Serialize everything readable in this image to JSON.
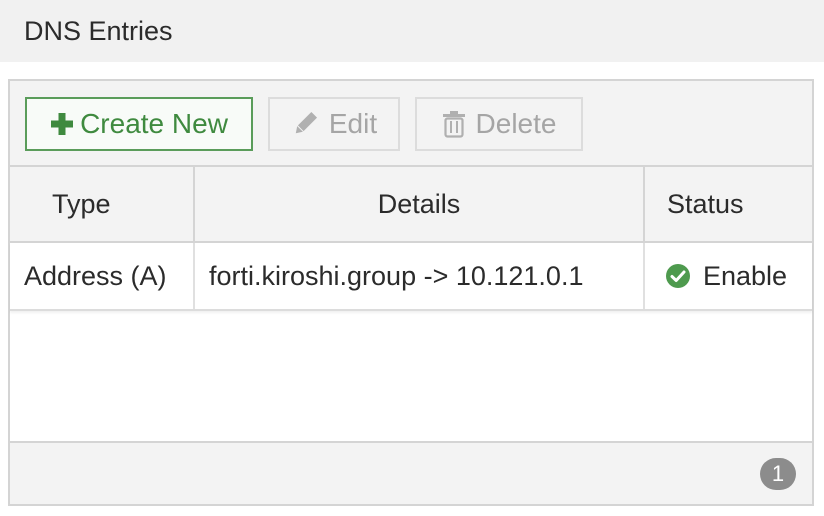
{
  "section": {
    "title": "DNS Entries"
  },
  "toolbar": {
    "create_label": "Create New",
    "edit_label": "Edit",
    "delete_label": "Delete"
  },
  "table": {
    "columns": [
      "Type",
      "Details",
      "Status"
    ],
    "rows": [
      {
        "type": "Address (A)",
        "details": "forti.kiroshi.group -> 10.121.0.1",
        "status": "Enable"
      }
    ]
  },
  "pagination": {
    "count": "1"
  },
  "colors": {
    "accent_green": "#3f8a3f",
    "status_enabled": "#4e9a4e",
    "badge_gray": "#8c8c8c"
  },
  "icons": {
    "create": "plus-icon",
    "edit": "pencil-icon",
    "delete": "trash-icon",
    "status": "check-circle-icon"
  }
}
